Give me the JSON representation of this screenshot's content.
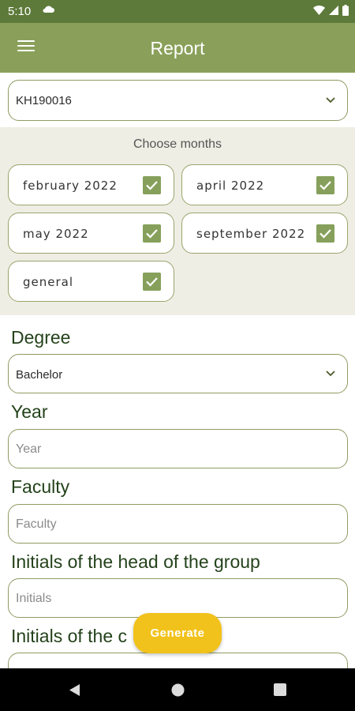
{
  "status": {
    "time": "5:10"
  },
  "app_bar": {
    "title": "Report"
  },
  "student_select": {
    "value": "KH190016"
  },
  "months": {
    "label": "Choose months",
    "items": [
      {
        "label": "february 2022",
        "checked": true
      },
      {
        "label": "april 2022",
        "checked": true
      },
      {
        "label": "may 2022",
        "checked": true
      },
      {
        "label": "september 2022",
        "checked": true
      },
      {
        "label": "general",
        "checked": true
      }
    ]
  },
  "form": {
    "degree": {
      "label": "Degree",
      "value": "Bachelor"
    },
    "year": {
      "label": "Year",
      "placeholder": "Year"
    },
    "faculty": {
      "label": "Faculty",
      "placeholder": "Faculty"
    },
    "head_initials": {
      "label": "Initials of the head of the group",
      "placeholder": "Initials"
    },
    "other_initials": {
      "label": "Initials of the c"
    }
  },
  "fab": {
    "label": "Generate"
  },
  "colors": {
    "status_bar": "#5d7a3a",
    "app_bar": "#8aa05a",
    "accent": "#86a05b",
    "fab": "#f1c21b",
    "label_text": "#24421b"
  },
  "icons": [
    "cloud-icon",
    "wifi-icon",
    "signal-icon",
    "battery-icon",
    "menu-icon",
    "chevron-down-icon",
    "checkbox-checked-icon",
    "back-icon",
    "home-icon",
    "recents-icon"
  ]
}
